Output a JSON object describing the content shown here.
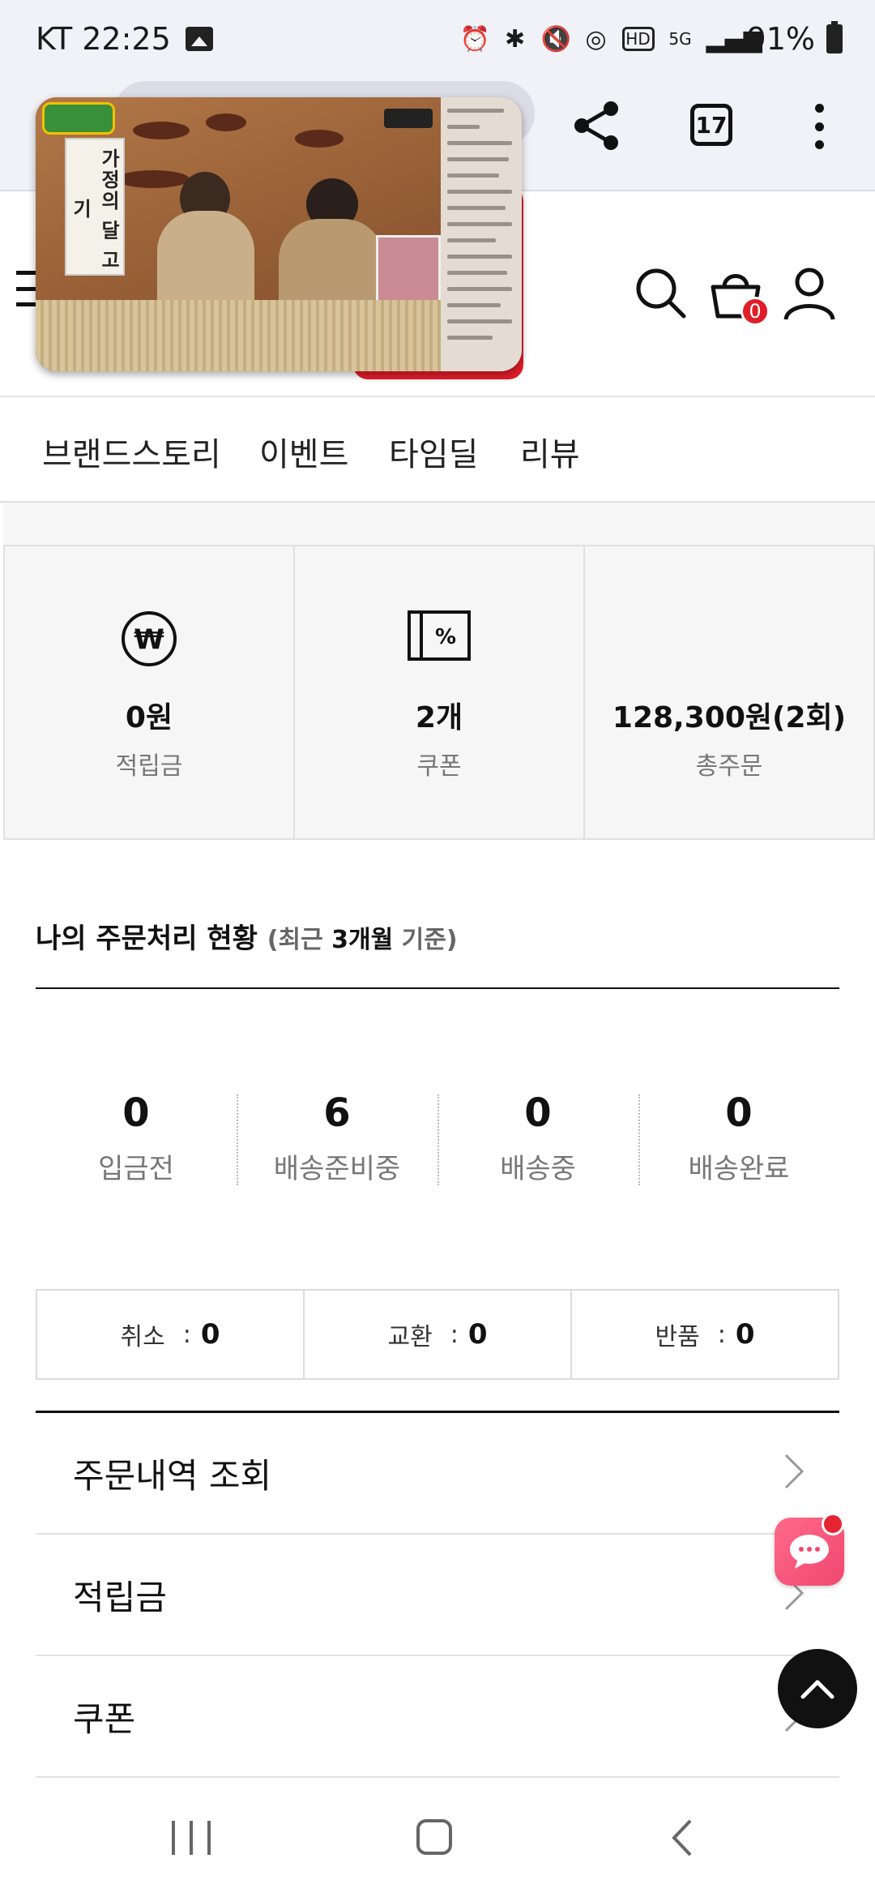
{
  "status_bar": {
    "carrier_time": "KT 22:25",
    "battery": "91%",
    "icons": [
      "gallery-icon",
      "alarm-icon",
      "bluetooth-icon",
      "mute-icon",
      "hotspot-icon",
      "hd-icon",
      "5g-icon",
      "signal-icon",
      "battery-icon"
    ]
  },
  "browser": {
    "tab_count": "17",
    "icons": [
      "share-icon",
      "tabs-icon",
      "more-icon"
    ]
  },
  "pip": {
    "sign_text": "가정의 달 고기"
  },
  "header": {
    "cart_count": "0",
    "icons": [
      "menu-icon",
      "search-icon",
      "cart-icon",
      "user-icon"
    ]
  },
  "categories": [
    "브랜드스토리",
    "이벤트",
    "타임딜",
    "리뷰"
  ],
  "summary": [
    {
      "icon": "won-icon",
      "value": "0원",
      "label": "적립금"
    },
    {
      "icon": "coupon-icon",
      "value": "2개",
      "label": "쿠폰"
    },
    {
      "icon": "",
      "value": "128,300원(2회)",
      "label": "총주문"
    }
  ],
  "order_status": {
    "title": "나의 주문처리 현황",
    "subtitle_pre": "(최근 ",
    "subtitle_bold": "3개월",
    "subtitle_post": " 기준)",
    "steps": [
      {
        "count": "0",
        "label": "입금전"
      },
      {
        "count": "6",
        "label": "배송준비중"
      },
      {
        "count": "0",
        "label": "배송중"
      },
      {
        "count": "0",
        "label": "배송완료"
      }
    ],
    "extras": [
      {
        "label": "취소",
        "sep": ":",
        "count": "0"
      },
      {
        "label": "교환",
        "sep": ":",
        "count": "0"
      },
      {
        "label": "반품",
        "sep": ":",
        "count": "0"
      }
    ]
  },
  "menu": [
    "주문내역 조회",
    "적립금",
    "쿠폰"
  ],
  "colors": {
    "accent_red": "#e01e28",
    "chat_pink": "#f04770",
    "panel_gray": "#f6f6f6"
  }
}
